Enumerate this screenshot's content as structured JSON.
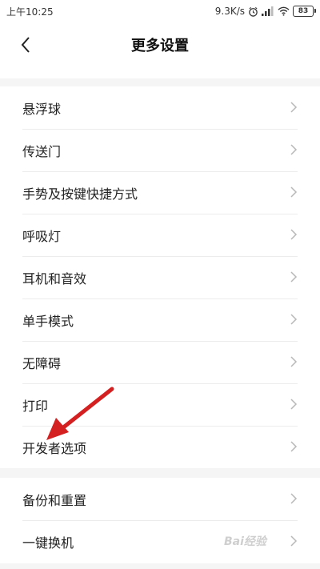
{
  "status_bar": {
    "time": "上午10:25",
    "network_speed": "9.3K/s",
    "battery": "83",
    "icons": [
      "alarm-icon",
      "signal-icon",
      "wifi-icon",
      "battery-icon"
    ]
  },
  "header": {
    "title": "更多设置",
    "back_icon": "back-chevron-icon"
  },
  "groups": [
    {
      "items": [
        {
          "label": "悬浮球"
        },
        {
          "label": "传送门"
        },
        {
          "label": "手势及按键快捷方式"
        },
        {
          "label": "呼吸灯"
        },
        {
          "label": "耳机和音效"
        },
        {
          "label": "单手模式"
        },
        {
          "label": "无障碍"
        },
        {
          "label": "打印"
        },
        {
          "label": "开发者选项"
        }
      ]
    },
    {
      "items": [
        {
          "label": "备份和重置"
        },
        {
          "label": "一键换机"
        }
      ]
    }
  ],
  "colors": {
    "background": "#ffffff",
    "separator_band": "#f5f5f5",
    "annotation_arrow": "#d42020",
    "chevron": "#b8b8b8"
  },
  "watermark": "Bai经验"
}
